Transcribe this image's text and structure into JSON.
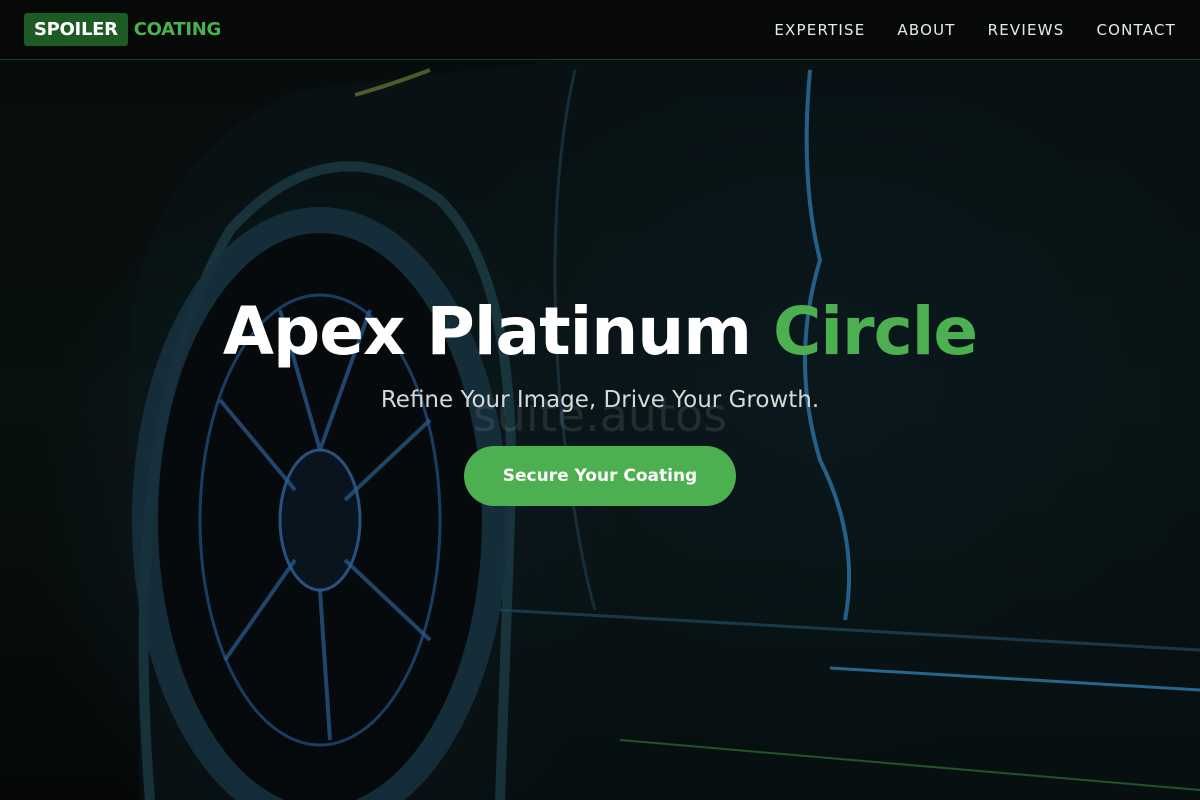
{
  "brand": {
    "logo_box_text": "SPOILER",
    "logo_text": "COATING",
    "accent_color": "#4caf50",
    "dark_accent_color": "#1e5a23"
  },
  "nav": {
    "items": [
      {
        "label": "EXPERTISE"
      },
      {
        "label": "ABOUT"
      },
      {
        "label": "REVIEWS"
      },
      {
        "label": "CONTACT"
      }
    ]
  },
  "hero": {
    "title_main": "Apex Platinum ",
    "title_accent": "Circle",
    "subtitle": "Refine Your Image, Drive Your Growth.",
    "watermark": "suite.autos",
    "cta_label": "Secure Your Coating",
    "background_image": "dark car side with wheel, blue and green rim light"
  }
}
